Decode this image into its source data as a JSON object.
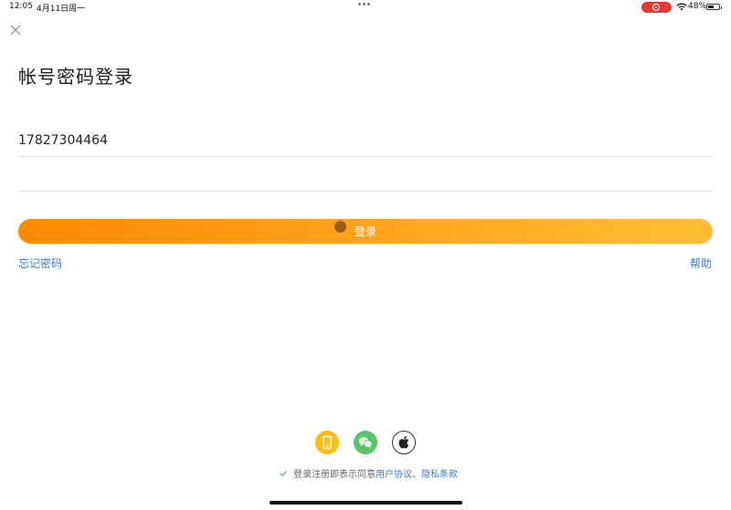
{
  "status_bar": {
    "time": "12:05",
    "date": "4月11日周一",
    "battery": "48%",
    "recording_color": "#e53935"
  },
  "page": {
    "title": "帐号密码登录"
  },
  "form": {
    "phone_value": "17827304464",
    "password_value": "",
    "login_label": "登录",
    "button_colors": [
      "#ff8a00",
      "#ffbd36"
    ]
  },
  "links": {
    "forgot": "忘记密码",
    "help": "帮助",
    "color": "#3d7ac4"
  },
  "social": {
    "items": [
      {
        "name": "phone-icon",
        "color": "#ffbe16"
      },
      {
        "name": "wechat-icon",
        "color": "#58c56b"
      },
      {
        "name": "apple-icon",
        "color": "#ffffff"
      }
    ]
  },
  "agreement": {
    "prefix": "登录注册即表示同意",
    "user_agreement": "用户协议",
    "separator": "、",
    "privacy": "隐私条款",
    "checked": true
  }
}
